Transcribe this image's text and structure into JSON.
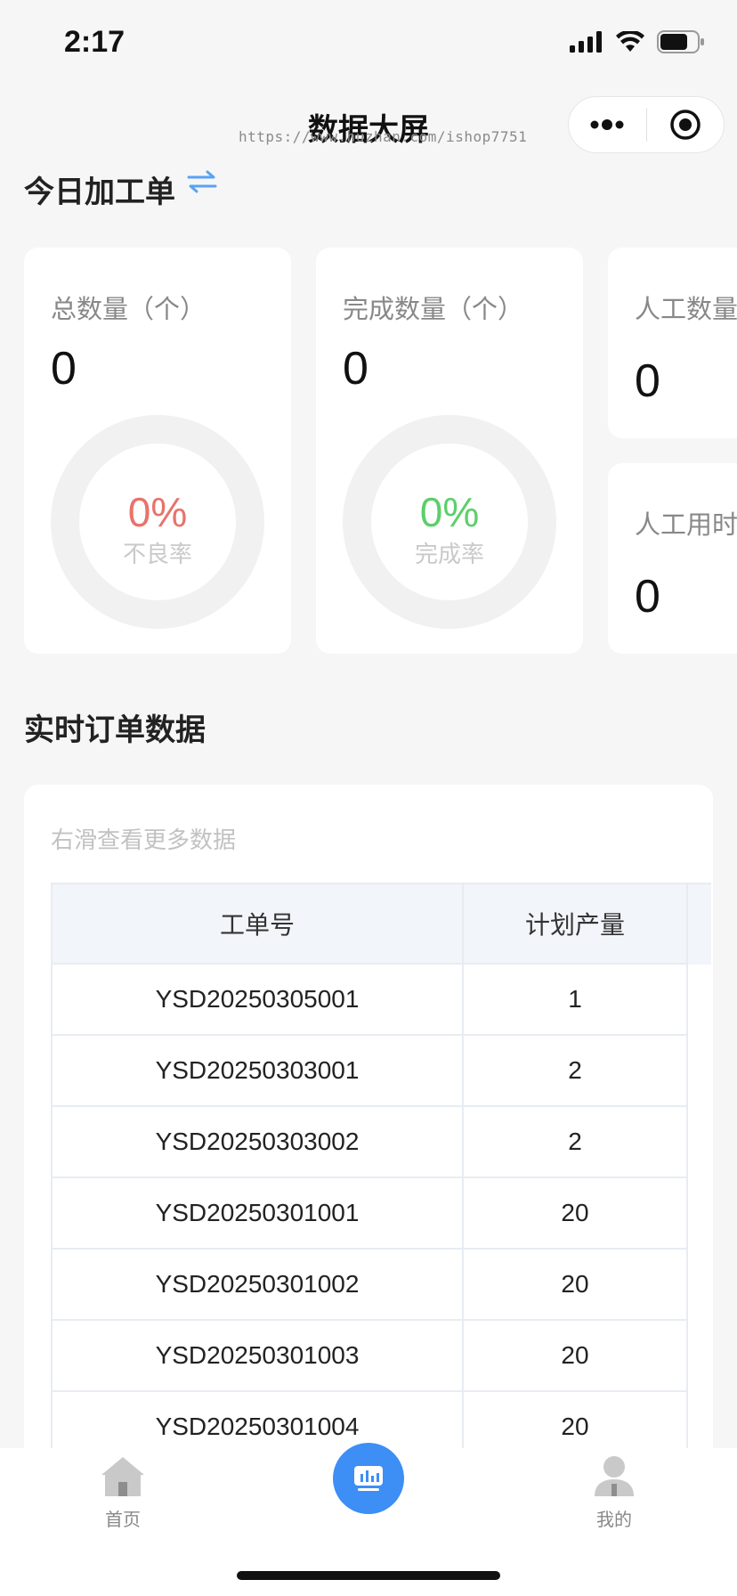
{
  "status_bar": {
    "time": "2:17"
  },
  "nav": {
    "title": "数据大屏",
    "watermark": "https://www.huzhan.com/ishop7751"
  },
  "section_today": {
    "title": "今日加工单"
  },
  "cards": {
    "total": {
      "label": "总数量（个）",
      "value": "0",
      "ring_pct": "0%",
      "ring_label": "不良率",
      "ring_color": "#e8736b"
    },
    "done": {
      "label": "完成数量（个）",
      "value": "0",
      "ring_pct": "0%",
      "ring_label": "完成率",
      "ring_color": "#5ccf6a"
    },
    "manual_count": {
      "label": "人工数量",
      "value": "0"
    },
    "manual_time": {
      "label": "人工用时",
      "value": "0"
    }
  },
  "section_orders": {
    "title": "实时订单数据",
    "hint": "右滑查看更多数据"
  },
  "orders_table": {
    "headers": [
      "工单号",
      "计划产量"
    ],
    "rows": [
      [
        "YSD20250305001",
        "1"
      ],
      [
        "YSD20250303001",
        "2"
      ],
      [
        "YSD20250303002",
        "2"
      ],
      [
        "YSD20250301001",
        "20"
      ],
      [
        "YSD20250301002",
        "20"
      ],
      [
        "YSD20250301003",
        "20"
      ],
      [
        "YSD20250301004",
        "20"
      ]
    ]
  },
  "tabbar": {
    "home": {
      "label": "首页",
      "icon": "home-icon"
    },
    "center": {
      "icon": "chart-screen-icon",
      "color": "#3d8ef5"
    },
    "mine": {
      "label": "我的",
      "icon": "user-icon"
    }
  }
}
